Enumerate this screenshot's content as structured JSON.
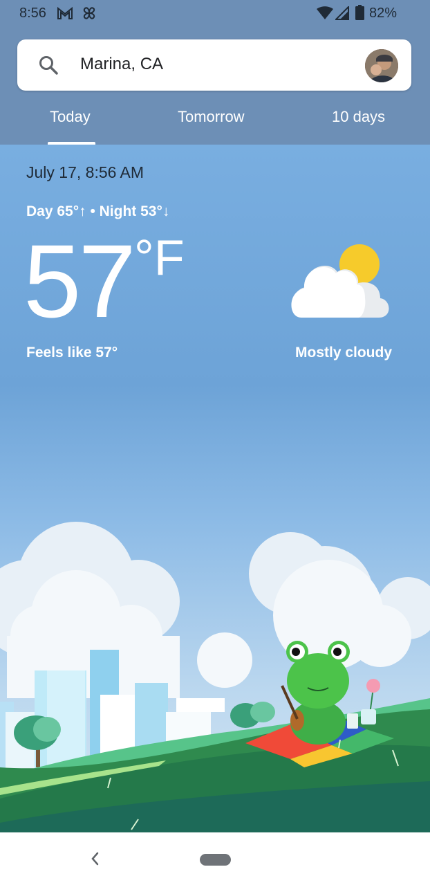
{
  "status_bar": {
    "time": "8:56",
    "battery": "82%",
    "icons": [
      "gmail-icon",
      "pinwheel-icon",
      "wifi-icon",
      "signal-icon",
      "battery-icon"
    ]
  },
  "search": {
    "location": "Marina, CA",
    "icon": "search-icon"
  },
  "tabs": [
    {
      "label": "Today",
      "selected": true
    },
    {
      "label": "Tomorrow",
      "selected": false
    },
    {
      "label": "10 days",
      "selected": false
    }
  ],
  "weather": {
    "datetime": "July 17, 8:56 AM",
    "day_night": "Day 65°↑ • Night 53°↓",
    "temperature": "57",
    "unit": "°F",
    "feels_like": "Feels like 57°",
    "condition": "Mostly cloudy",
    "condition_icon": "partly-cloudy-icon"
  },
  "colors": {
    "header": "#6d8fb6",
    "sky_top": "#79aee0",
    "grass": "#2f8a4e",
    "frog": "#4cc34a"
  }
}
